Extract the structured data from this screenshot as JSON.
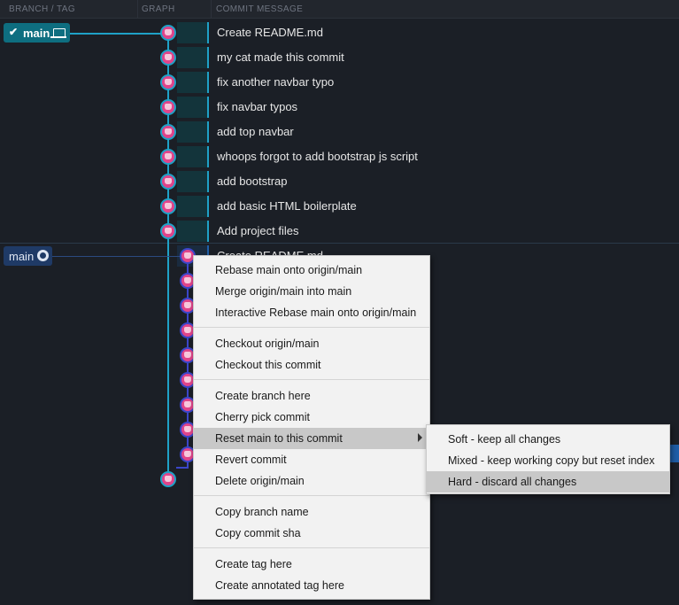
{
  "header": {
    "branch_tag": "BRANCH / TAG",
    "graph": "GRAPH",
    "commit_message": "COMMIT MESSAGE"
  },
  "branches": {
    "local": {
      "name": "main",
      "icon": "laptop-icon",
      "checked": true
    },
    "remote": {
      "name": "main",
      "icon": "github-icon"
    }
  },
  "local_commits": [
    "Create README.md",
    "my cat made this commit",
    "fix another navbar typo",
    "fix navbar typos",
    "add top navbar",
    "whoops forgot to add bootstrap js script",
    "add bootstrap",
    "add basic HTML boilerplate",
    "Add project files"
  ],
  "remote_commits": [
    "Create README.md"
  ],
  "context_menu": {
    "groups": [
      [
        "Rebase main onto origin/main",
        "Merge origin/main into main",
        "Interactive Rebase main onto origin/main"
      ],
      [
        "Checkout origin/main",
        "Checkout this commit"
      ],
      [
        "Create branch here",
        "Cherry pick commit",
        "Reset main to this commit",
        "Revert commit",
        "Delete origin/main"
      ],
      [
        "Copy branch name",
        "Copy commit sha"
      ],
      [
        "Create tag here",
        "Create annotated tag here"
      ]
    ],
    "highlighted": "Reset main to this commit"
  },
  "submenu": {
    "items": [
      "Soft - keep all changes",
      "Mixed - keep working copy but reset index",
      "Hard - discard all changes"
    ],
    "highlighted": "Hard - discard all changes"
  },
  "colors": {
    "accent": "#1fa1c7",
    "remote": "#3b46c9",
    "node": "#e0448a"
  }
}
